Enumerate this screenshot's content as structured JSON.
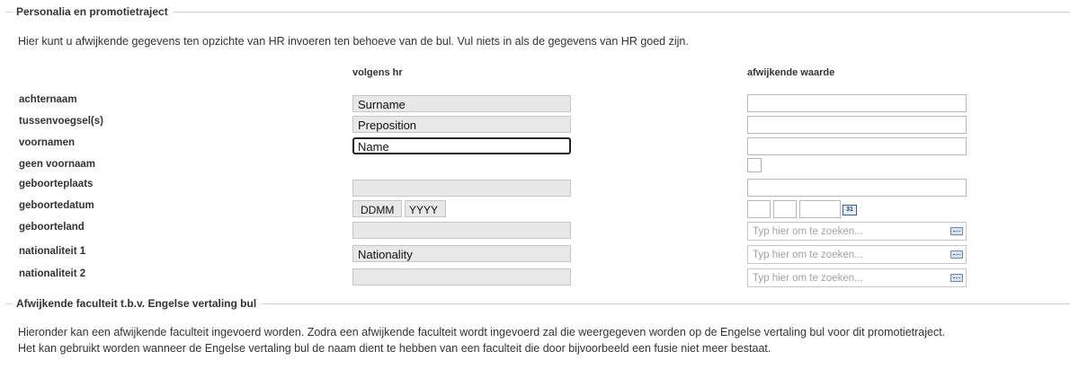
{
  "section1": {
    "legend": "Personalia en promotietraject",
    "intro": "Hier kunt u afwijkende gegevens ten opzichte van HR invoeren ten behoeve van de bul. Vul niets in als de gegevens van HR goed zijn.",
    "col_hr": "volgens hr",
    "col_alt": "afwijkende waarde",
    "rows": {
      "achternaam": {
        "label": "achternaam",
        "hr_value": "Surname"
      },
      "tussenvoegsel": {
        "label": "tussenvoegsel(s)",
        "hr_value": "Preposition"
      },
      "voornamen": {
        "label": "voornamen",
        "hr_value": "Name"
      },
      "geen_voornaam": {
        "label": "geen voornaam"
      },
      "geboorteplaats": {
        "label": "geboorteplaats",
        "hr_value": ""
      },
      "geboortedatum": {
        "label": "geboortedatum",
        "hr_ddmm": "DDMM",
        "hr_yyyy": "YYYY",
        "calendar_icon_text": "31"
      },
      "geboorteland": {
        "label": "geboorteland",
        "hr_value": "",
        "search_placeholder": "Typ hier om te zoeken..."
      },
      "nationaliteit1": {
        "label": "nationaliteit 1",
        "hr_value": "Nationality",
        "search_placeholder": "Typ hier om te zoeken..."
      },
      "nationaliteit2": {
        "label": "nationaliteit 2",
        "hr_value": "",
        "search_placeholder": "Typ hier om te zoeken..."
      }
    }
  },
  "section2": {
    "legend": "Afwijkende faculteit t.b.v. Engelse vertaling bul",
    "intro_line1": "Hieronder kan een afwijkende faculteit ingevoerd worden. Zodra een afwijkende faculteit wordt ingevoerd zal die weergegeven worden op de Engelse vertaling bul voor dit promotietraject.",
    "intro_line2": "Het kan gebruikt worden wanneer de Engelse vertaling bul de naam dient te hebben van een faculteit die door bijvoorbeeld een fusie niet meer bestaat."
  },
  "icons": {
    "calendar": "calendar-icon",
    "keyboard": "keyboard-icon"
  }
}
